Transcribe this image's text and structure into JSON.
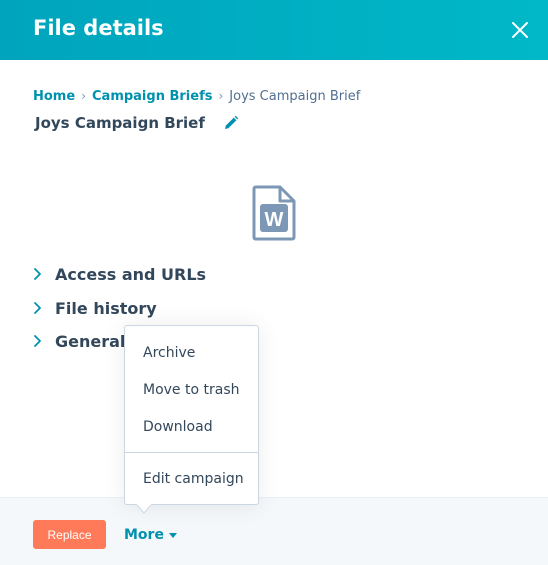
{
  "header": {
    "title": "File details",
    "close_icon": "close-icon",
    "background": "#00a4bd"
  },
  "breadcrumb": {
    "items": [
      "Home",
      "Campaign Briefs"
    ],
    "current": "Joys Campaign Brief"
  },
  "file": {
    "name": "Joys Campaign Brief",
    "edit_icon": "pencil-icon",
    "type_icon": "word-document-icon",
    "type_letter": "W"
  },
  "sections": [
    {
      "label": "Access and URLs"
    },
    {
      "label": "File history"
    },
    {
      "label": "General"
    }
  ],
  "footer": {
    "replace_label": "Replace",
    "more_label": "More"
  },
  "more_menu": {
    "items": [
      "Archive",
      "Move to trash",
      "Download"
    ],
    "secondary_items": [
      "Edit campaign"
    ]
  },
  "colors": {
    "accent": "#0091ae",
    "primary_button": "#ff7a59",
    "text": "#33475b"
  }
}
